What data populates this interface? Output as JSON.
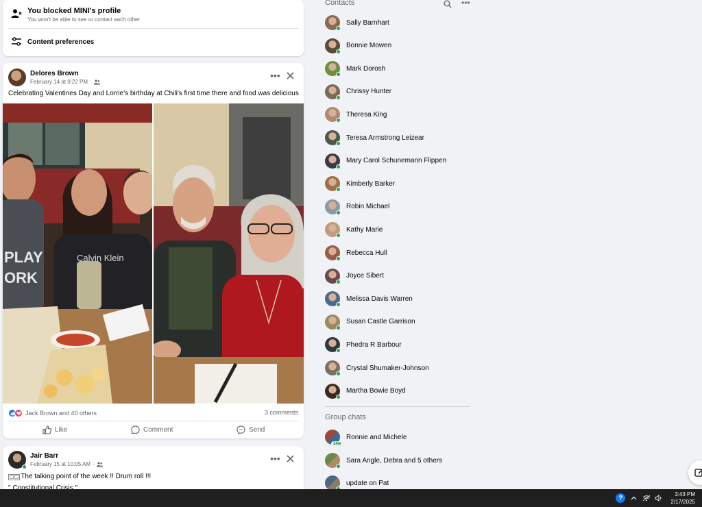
{
  "blocked": {
    "title": "You blocked MINI's profile",
    "subtitle": "You won't be able to see or contact each other.",
    "preferences_label": "Content preferences"
  },
  "post1": {
    "author": "Delores Brown",
    "date": "February 14 at 9:22 PM",
    "text": "Celebrating Valentines Day and Lorrie's birthday at Chili's first time there and food was delicious",
    "reactions_text": "Jack Brown and 40 others",
    "comments_text": "3 comments",
    "actions": {
      "like": "Like",
      "comment": "Comment",
      "send": "Send"
    }
  },
  "post2": {
    "author": "Jair Barr",
    "date": "February 15 at 10:05 AM",
    "text_line1": "The talking point of the week !! Drum roll  !!!",
    "text_line2": "\" Constitutional Crisis \""
  },
  "sidebar": {
    "contacts_title": "Contacts",
    "contacts": [
      {
        "name": "Sally Barnhart",
        "color": "#8a6a52"
      },
      {
        "name": "Bonnie Mowen",
        "color": "#5a4a3a"
      },
      {
        "name": "Mark Dorosh",
        "color": "#6b8f3c"
      },
      {
        "name": "Chrissy Hunter",
        "color": "#7a6a58"
      },
      {
        "name": "Theresa King",
        "color": "#b08a70"
      },
      {
        "name": "Teresa Armstrong Leizear",
        "color": "#4a5a4a"
      },
      {
        "name": "Mary Carol Schunemann Flippen",
        "color": "#3a3a44"
      },
      {
        "name": "Kimberly Barker",
        "color": "#a0704c"
      },
      {
        "name": "Robin Michael",
        "color": "#8c9aa8"
      },
      {
        "name": "Kathy Marie",
        "color": "#c09a7a"
      },
      {
        "name": "Rebecca Hull",
        "color": "#9a5a48"
      },
      {
        "name": "Joyce Sibert",
        "color": "#6a4a4a"
      },
      {
        "name": "Melissa Davis Warren",
        "color": "#4a6a8a"
      },
      {
        "name": "Susan Castle Garrison",
        "color": "#9a8a60"
      },
      {
        "name": "Phedra R Barbour",
        "color": "#2f3a40"
      },
      {
        "name": "Crystal Shumaker-Johnson",
        "color": "#7a7060"
      },
      {
        "name": "Martha Bowie Boyd",
        "color": "#3a2a20"
      }
    ],
    "group_title": "Group chats",
    "groups": [
      {
        "name": "Ronnie and Michele",
        "badge": "14w"
      },
      {
        "name": "Sara Angle, Debra and 5 others"
      },
      {
        "name": "update on Pat"
      }
    ]
  },
  "taskbar": {
    "time": "3:43 PM",
    "date": "2/17/2025"
  },
  "colors": {
    "accent": "#1877f2",
    "online": "#31a24c",
    "background": "#f0f2f5"
  }
}
